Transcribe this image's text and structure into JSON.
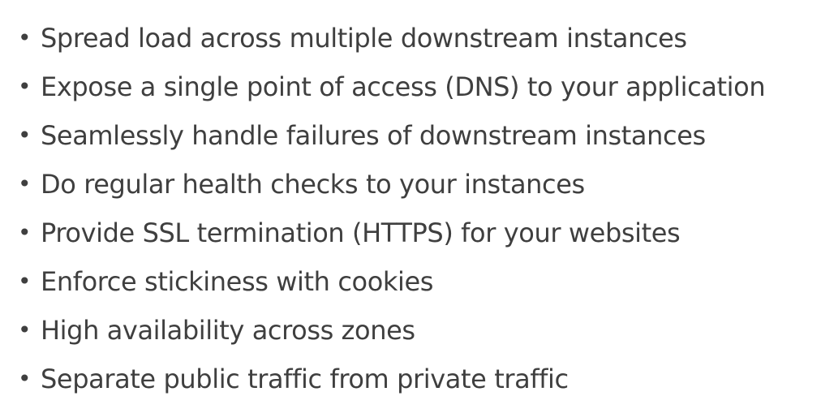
{
  "bullets": [
    "Spread load across multiple downstream instances",
    "Expose a single point of access (DNS) to your application",
    "Seamlessly handle failures of downstream instances",
    "Do regular health checks to your instances",
    "Provide SSL termination (HTTPS) for your websites",
    "Enforce stickiness with cookies",
    "High availability across zones",
    "Separate public traffic from private traffic"
  ],
  "bullet_glyph": "•"
}
